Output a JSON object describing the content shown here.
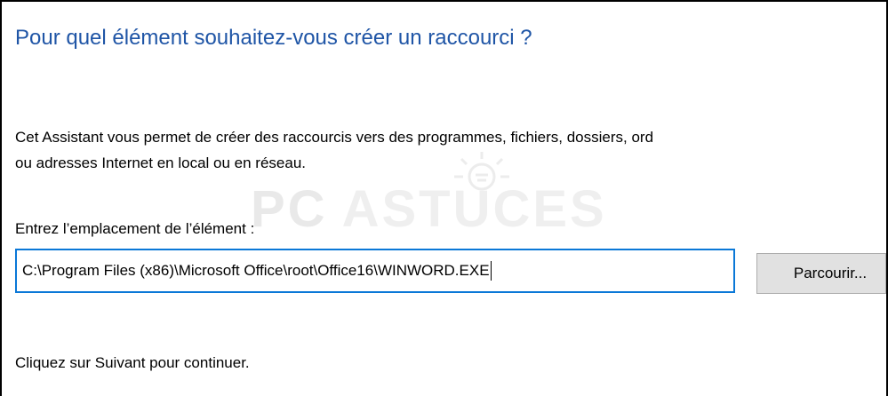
{
  "dialog": {
    "heading": "Pour quel élément souhaitez-vous créer un raccourci ?",
    "description_lines": [
      "Cet Assistant vous permet de créer des raccourcis vers des programmes, fichiers, dossiers, ord",
      "ou adresses Internet en local ou en réseau."
    ],
    "location_label": "Entrez l’emplacement de l’élément :",
    "location_value": "C:\\Program Files (x86)\\Microsoft Office\\root\\Office16\\WINWORD.EXE",
    "browse_label": "Parcourir...",
    "footer_text": "Cliquez sur Suivant pour continuer."
  },
  "watermark": {
    "text_pc": "PC",
    "text_main": "ASTUCES"
  },
  "colors": {
    "heading": "#1f55a6",
    "input_border_focus": "#0a78d7",
    "button_background": "#e1e1e1",
    "button_border": "#adadad"
  },
  "icons": {
    "watermark_logo": "sun-lightbulb-icon"
  }
}
